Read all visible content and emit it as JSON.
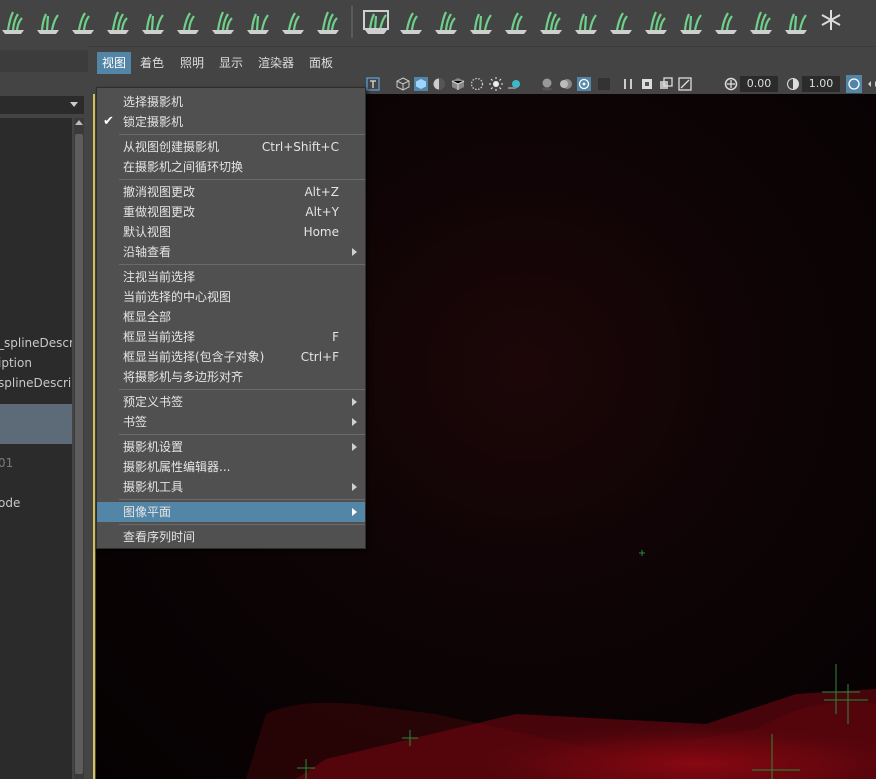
{
  "shelf": {
    "icons": [
      "add-guide-icon",
      "sculpt-tool-icon",
      "lock-guide-icon",
      "grass-brush-icon",
      "grid-plane-icon",
      "rotate-tool-icon",
      "select-guide-icon",
      "curve-tool-icon",
      "cut-guide-icon",
      "export-guide-icon",
      "preview-window-icon",
      "add-modifier-icon",
      "clump-guide-icon",
      "comb-guide-icon",
      "lift-guide-icon",
      "placement-guide-icon",
      "pose-guide-icon",
      "twist-guide-icon",
      "scale-guide-icon",
      "noise-guide-icon",
      "smooth-guide-icon",
      "width-guide-icon",
      "cut-length-icon",
      "snow-icon"
    ]
  },
  "outliner": {
    "items": [
      {
        "label": "_splineDescr"
      },
      {
        "label": "iption"
      },
      {
        "label": "splineDescrip"
      },
      {
        "label": "01"
      },
      {
        "label": "ode"
      }
    ]
  },
  "panel_menu": {
    "items": [
      "视图",
      "着色",
      "照明",
      "显示",
      "渲染器",
      "面板"
    ]
  },
  "panel_toolbar": {
    "exposure_value": "0.00",
    "gamma_value": "1.00"
  },
  "view_menu": {
    "items": [
      {
        "label": "选择摄影机",
        "shortcut": ""
      },
      {
        "label": "锁定摄影机",
        "shortcut": "",
        "checked": "✔"
      },
      {
        "label": "从视图创建摄影机",
        "shortcut": "Ctrl+Shift+C"
      },
      {
        "label": "在摄影机之间循环切换",
        "shortcut": ""
      },
      {
        "label": "撤消视图更改",
        "shortcut": "Alt+Z"
      },
      {
        "label": "重做视图更改",
        "shortcut": "Alt+Y"
      },
      {
        "label": "默认视图",
        "shortcut": "Home"
      },
      {
        "label": "沿轴查看",
        "shortcut": ""
      },
      {
        "label": "注视当前选择",
        "shortcut": ""
      },
      {
        "label": "当前选择的中心视图",
        "shortcut": ""
      },
      {
        "label": "框显全部",
        "shortcut": ""
      },
      {
        "label": "框显当前选择",
        "shortcut": "F"
      },
      {
        "label": "框显当前选择(包含子对象)",
        "shortcut": "Ctrl+F"
      },
      {
        "label": "将摄影机与多边形对齐",
        "shortcut": ""
      },
      {
        "label": "预定义书签",
        "shortcut": ""
      },
      {
        "label": "书签",
        "shortcut": ""
      },
      {
        "label": "摄影机设置",
        "shortcut": ""
      },
      {
        "label": "摄影机属性编辑器...",
        "shortcut": ""
      },
      {
        "label": "摄影机工具",
        "shortcut": ""
      },
      {
        "label": "图像平面",
        "shortcut": ""
      },
      {
        "label": "查看序列时间",
        "shortcut": ""
      }
    ]
  },
  "colors": {
    "accent": "#5285a6",
    "shelf_icon_green": "#6fd08a",
    "viewport_bg": "#0a0304",
    "viewport_red": "#8a0a14",
    "marker_green": "#2a8a3a"
  }
}
